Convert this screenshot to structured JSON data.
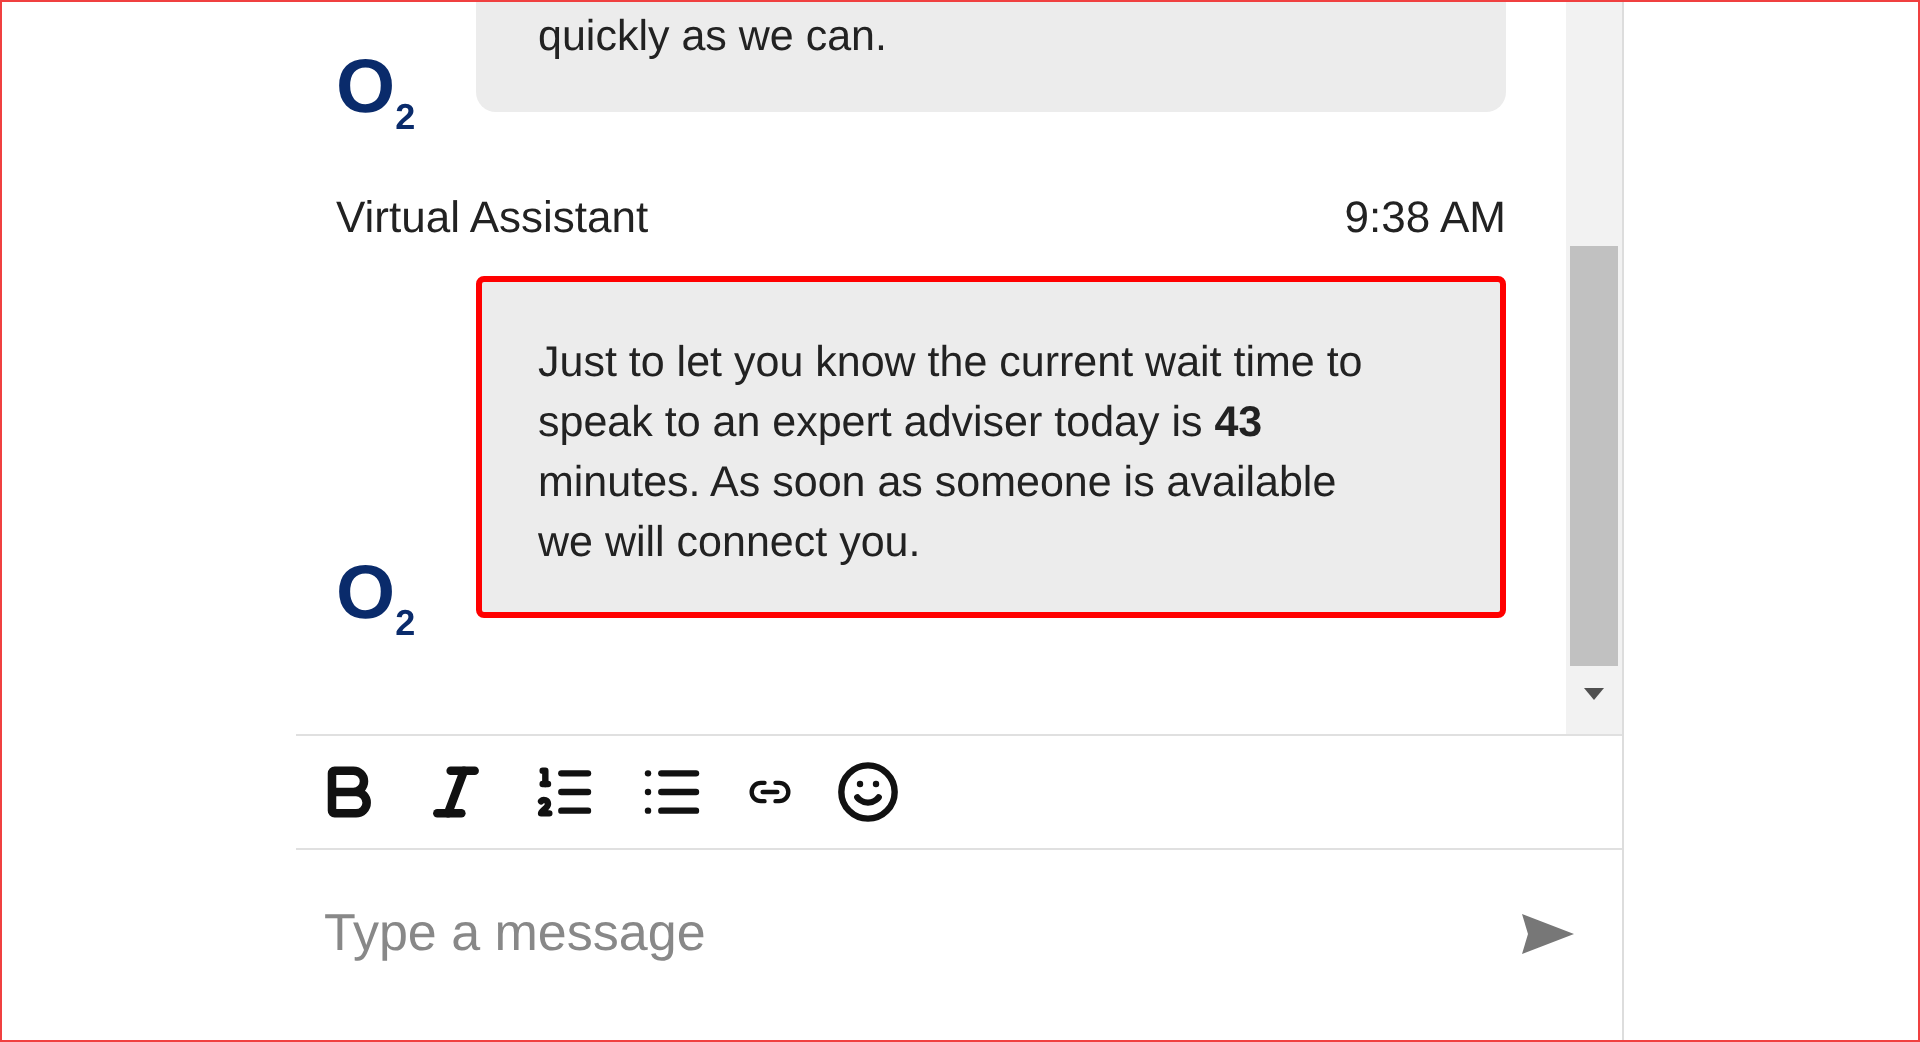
{
  "messages": [
    {
      "kind": "bot",
      "logo": "O$_{2}$",
      "text": "quickly as we can.",
      "cut_top": true,
      "highlighted": false
    },
    {
      "kind": "bot",
      "sender": "Virtual Assistant",
      "time": "9:38 AM",
      "logo": "O$_{2}$",
      "text": "Just to let you know the current wait time to speak to an expert adviser today is **43** minutes. As soon as someone is available we will connect you.",
      "cut_top": false,
      "highlighted": true
    }
  ],
  "toolbar": [
    {
      "kind": "bold"
    },
    {
      "kind": "italic"
    },
    {
      "kind": "numbered-list"
    },
    {
      "kind": "bulleted-list"
    },
    {
      "kind": "link"
    },
    {
      "kind": "emoji"
    }
  ],
  "composer": {
    "placeholder": "Type a message"
  }
}
